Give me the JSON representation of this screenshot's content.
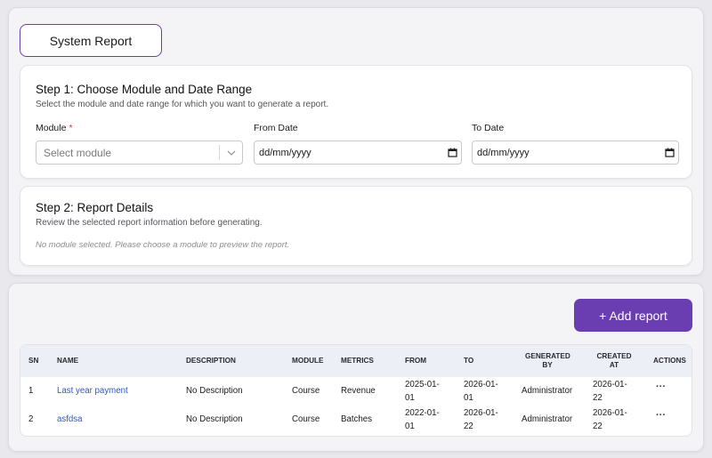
{
  "page": {
    "title": "System Report"
  },
  "step1": {
    "title": "Step 1: Choose Module and Date Range",
    "subtitle": "Select the module and date range for which you want to generate a report.",
    "module_label": "Module",
    "module_required_marker": "*",
    "module_placeholder": "Select module",
    "from_label": "From Date",
    "from_value": "dd/mm/yyyy",
    "to_label": "To Date",
    "to_value": "dd/mm/yyyy"
  },
  "step2": {
    "title": "Step 2: Report Details",
    "subtitle": "Review the selected report information before generating.",
    "empty_message": "No module selected. Please choose a module to preview the report."
  },
  "toolbar": {
    "add_report_label": "+ Add report"
  },
  "table": {
    "headers": {
      "sn": "SN",
      "name": "NAME",
      "description": "DESCRIPTION",
      "module": "MODULE",
      "metrics": "METRICS",
      "from": "FROM",
      "to": "TO",
      "generated_by_1": "GENERATED",
      "generated_by_2": "BY",
      "created_at_1": "CREATED",
      "created_at_2": "AT",
      "actions": "ACTIONS"
    },
    "rows": [
      {
        "sn": "1",
        "name": "Last year payment",
        "description": "No Description",
        "module": "Course",
        "metrics": "Revenue",
        "from_1": "2025-01-",
        "from_2": "01",
        "to_1": "2026-01-",
        "to_2": "01",
        "generated_by": "Administrator",
        "created_1": "2026-01-",
        "created_2": "22",
        "actions": "···"
      },
      {
        "sn": "2",
        "name": "asfdsa",
        "description": "No Description",
        "module": "Course",
        "metrics": "Batches",
        "from_1": "2022-01-",
        "from_2": "01",
        "to_1": "2026-01-",
        "to_2": "22",
        "generated_by": "Administrator",
        "created_1": "2026-01-",
        "created_2": "22",
        "actions": "···"
      }
    ]
  },
  "colors": {
    "accent": "#6a3eb0",
    "link": "#2f56c9",
    "required": "#d83a3a",
    "table_header_bg": "#eceff5"
  },
  "icons": {
    "select_chevron": "chevron-down-icon",
    "date_picker": "calendar-icon",
    "row_actions": "more-horizontal-icon"
  }
}
